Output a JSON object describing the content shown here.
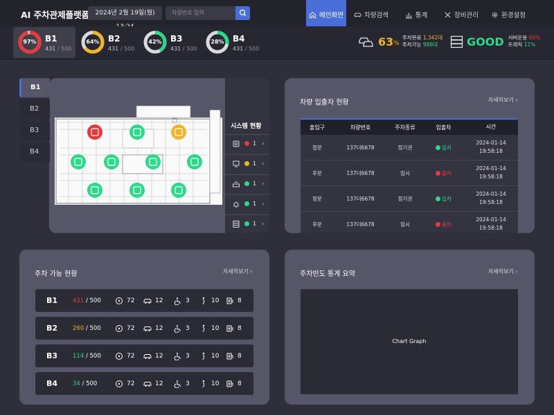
{
  "app": {
    "title": "AI 주차관제플랫폼",
    "datetime": "2024년 2월 19일(월) 13:24",
    "search_placeholder": "차량번호 입력"
  },
  "nav": [
    {
      "label": "메인화면",
      "icon": "home-icon",
      "active": true
    },
    {
      "label": "차량검색",
      "icon": "car-icon",
      "active": false
    },
    {
      "label": "통계",
      "icon": "bar-chart-icon",
      "active": false
    },
    {
      "label": "장비관리",
      "icon": "tools-icon",
      "active": false
    },
    {
      "label": "환경설정",
      "icon": "gear-icon",
      "active": false
    }
  ],
  "floors_gauge": [
    {
      "name": "B1",
      "percent": 97,
      "pct_label": "97%",
      "used": "431",
      "total": "/ 500",
      "color": "#e83a3a",
      "active": true
    },
    {
      "name": "B2",
      "percent": 64,
      "pct_label": "64%",
      "used": "431",
      "total": "/ 500",
      "color": "#f0b429",
      "active": false
    },
    {
      "name": "B3",
      "percent": 42,
      "pct_label": "42%",
      "used": "431",
      "total": "/ 500",
      "color": "#2dd88b",
      "active": false
    },
    {
      "name": "B4",
      "percent": 28,
      "pct_label": "28%",
      "used": "431",
      "total": "/ 500",
      "color": "#2dd88b",
      "active": false
    }
  ],
  "occupancy": {
    "value": "63",
    "unit": "%",
    "line1_label": "주차완료",
    "line1_value": "1,342대",
    "line2_label": "주차가능",
    "line2_value": "988대"
  },
  "server": {
    "status": "GOOD",
    "line1_label": "서버운용",
    "line1_value": "90%",
    "line2_label": "트래픽",
    "line2_value": "11%"
  },
  "map": {
    "tabs": [
      "B1",
      "B2",
      "B3",
      "B4"
    ],
    "active_tab": "B1",
    "system_title": "시스템 현황",
    "system_items": [
      {
        "icon": "camera-icon",
        "status": "red",
        "count": "1"
      },
      {
        "icon": "display-icon",
        "status": "yellow",
        "count": "1"
      },
      {
        "icon": "router-icon",
        "status": "green",
        "count": "1"
      },
      {
        "icon": "bell-icon",
        "status": "green",
        "count": "1"
      },
      {
        "icon": "server-icon",
        "status": "green",
        "count": "1"
      }
    ]
  },
  "entry": {
    "title": "차량 입출차 현황",
    "more": "자세히보기",
    "columns": [
      "출입구",
      "차량번호",
      "주차종류",
      "입출차",
      "시간"
    ],
    "rows": [
      {
        "gate": "정문",
        "plate": "137더6678",
        "type": "정기권",
        "status": "입차",
        "status_color": "#2dd88b",
        "date": "2024-01-14",
        "time": "19:58:18"
      },
      {
        "gate": "후문",
        "plate": "137더6678",
        "type": "임시",
        "status": "출차",
        "status_color": "#e83a3a",
        "date": "2024-01-14",
        "time": "19:58:18"
      },
      {
        "gate": "정문",
        "plate": "137더6678",
        "type": "정기권",
        "status": "입차",
        "status_color": "#2dd88b",
        "date": "2024-01-14",
        "time": "19:58:18"
      },
      {
        "gate": "후문",
        "plate": "137더6678",
        "type": "임시",
        "status": "출차",
        "status_color": "#e83a3a",
        "date": "2024-01-14",
        "time": "19:58:18"
      }
    ]
  },
  "parking": {
    "title": "주차 가능 현황",
    "more": "자세히보기",
    "rows": [
      {
        "floor": "B1",
        "avail": "431",
        "total": "/ 500",
        "color": "#e83a3a",
        "wheel": "72",
        "car": "12",
        "disabled": "3",
        "pregnant": "10",
        "ev": "8"
      },
      {
        "floor": "B2",
        "avail": "260",
        "total": "/ 500",
        "color": "#f0b429",
        "wheel": "72",
        "car": "12",
        "disabled": "3",
        "pregnant": "10",
        "ev": "8"
      },
      {
        "floor": "B3",
        "avail": "114",
        "total": "/ 500",
        "color": "#2dd88b",
        "wheel": "72",
        "car": "12",
        "disabled": "3",
        "pregnant": "10",
        "ev": "8"
      },
      {
        "floor": "B4",
        "avail": "34",
        "total": "/ 500",
        "color": "#2dd88b",
        "wheel": "72",
        "car": "12",
        "disabled": "3",
        "pregnant": "10",
        "ev": "8"
      }
    ]
  },
  "stats": {
    "title": "주차빈도 통계 요약",
    "more": "자세히보기",
    "chart_placeholder": "Chart Graph"
  },
  "colors": {
    "accent": "#4a6ed8",
    "red": "#e83a3a",
    "yellow": "#f0b429",
    "green": "#2dd88b"
  }
}
